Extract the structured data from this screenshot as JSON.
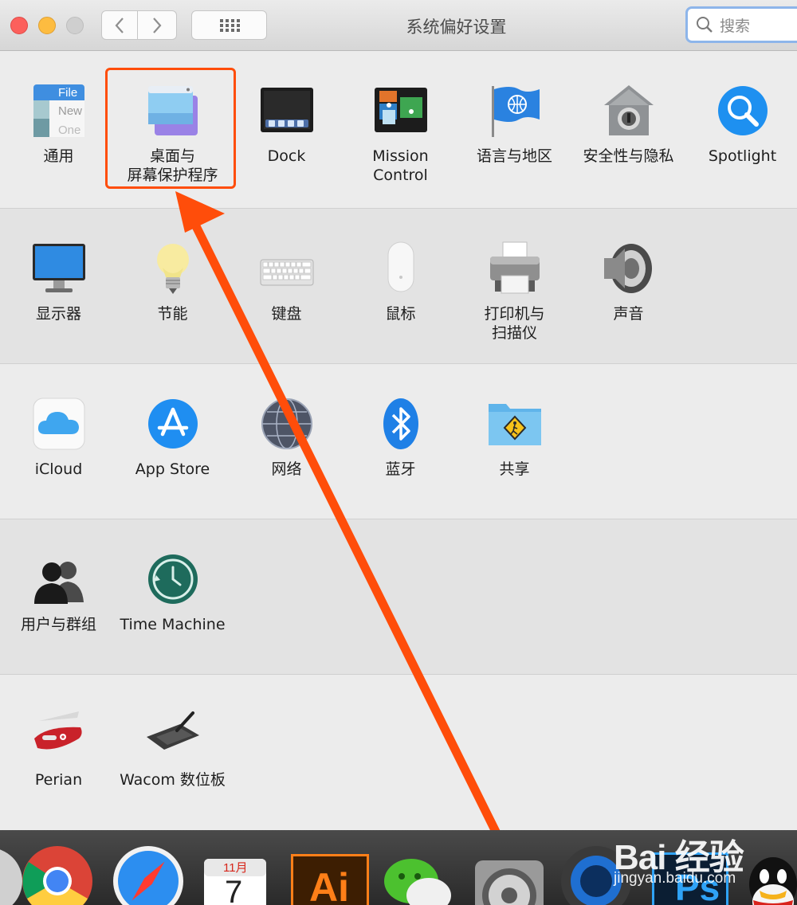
{
  "window": {
    "title": "系统偏好设置",
    "search_placeholder": "搜索"
  },
  "sections": [
    {
      "panes": [
        {
          "label": "通用",
          "icon": "general-icon"
        },
        {
          "label": "桌面与\n屏幕保护程序",
          "icon": "desktop-screensaver-icon"
        },
        {
          "label": "Dock",
          "icon": "dock-icon"
        },
        {
          "label": "Mission\nControl",
          "icon": "mission-control-icon"
        },
        {
          "label": "语言与地区",
          "icon": "language-flag-icon"
        },
        {
          "label": "安全性与隐私",
          "icon": "security-house-icon"
        },
        {
          "label": "Spotlight",
          "icon": "spotlight-icon"
        }
      ]
    },
    {
      "panes": [
        {
          "label": "显示器",
          "icon": "display-icon"
        },
        {
          "label": "节能",
          "icon": "energy-bulb-icon"
        },
        {
          "label": "键盘",
          "icon": "keyboard-icon"
        },
        {
          "label": "鼠标",
          "icon": "mouse-icon"
        },
        {
          "label": "打印机与\n扫描仪",
          "icon": "printer-icon"
        },
        {
          "label": "声音",
          "icon": "speaker-icon"
        }
      ]
    },
    {
      "panes": [
        {
          "label": "iCloud",
          "icon": "icloud-icon"
        },
        {
          "label": "App Store",
          "icon": "app-store-icon"
        },
        {
          "label": "网络",
          "icon": "network-globe-icon"
        },
        {
          "label": "蓝牙",
          "icon": "bluetooth-icon"
        },
        {
          "label": "共享",
          "icon": "sharing-folder-icon"
        }
      ]
    },
    {
      "panes": [
        {
          "label": "用户与群组",
          "icon": "users-groups-icon"
        },
        {
          "label": "Time Machine",
          "icon": "time-machine-icon"
        }
      ]
    },
    {
      "panes": [
        {
          "label": "Perian",
          "icon": "perian-knife-icon"
        },
        {
          "label": "Wacom 数位板",
          "icon": "wacom-tablet-icon"
        }
      ]
    }
  ],
  "general_icon_text": {
    "line1": "File",
    "line2": "New",
    "line3": "One"
  },
  "dock": {
    "calendar_month": "11月",
    "calendar_day": "7",
    "illustrator_label": "Ai",
    "photoshop_label": "Ps"
  },
  "watermark": {
    "brand": "Bai 经验",
    "site": "jingyan.baidu.com"
  },
  "colors": {
    "highlight": "#ff4d0a",
    "arrow": "#ff4d0a",
    "search_focus": "#8db5ea"
  }
}
